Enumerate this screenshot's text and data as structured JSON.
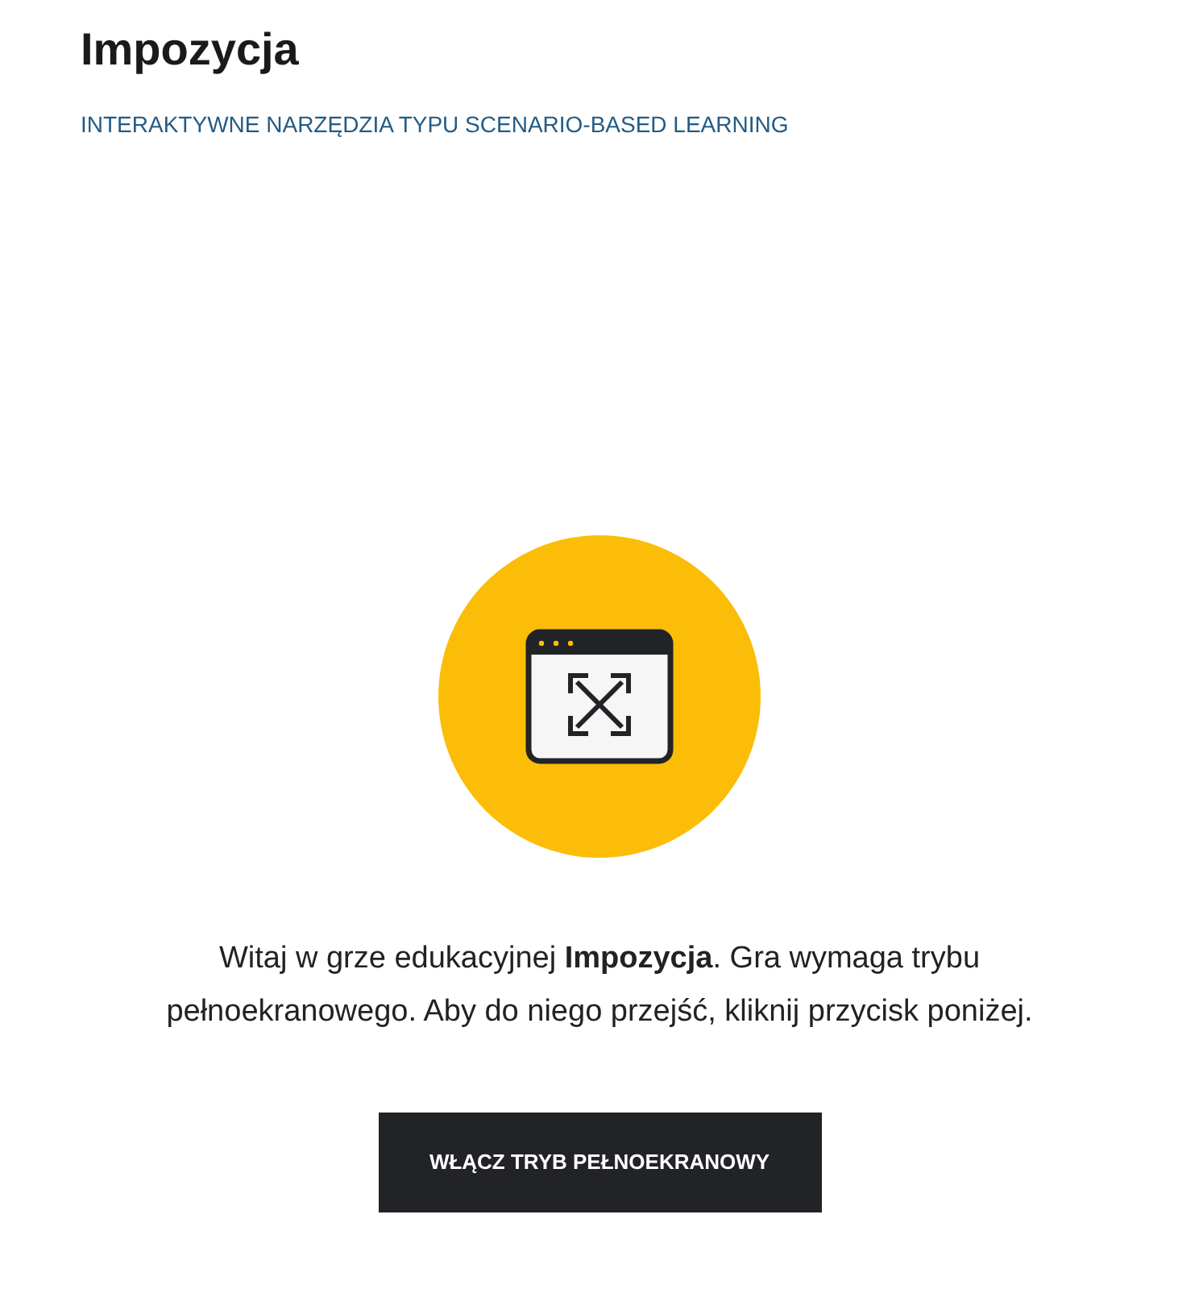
{
  "title": "Impozycja",
  "subtitle": "INTERAKTYWNE NARZĘDZIA TYPU SCENARIO-BASED LEARNING",
  "intro": "Witaj w grze edukacyjnej **Impozycja**. Gra wymaga trybu pełnoekranowego. Aby do niego przejść, kliknij przycisk poniżej.",
  "button": "WŁĄCZ TRYB PEŁNOEKRANOWY"
}
